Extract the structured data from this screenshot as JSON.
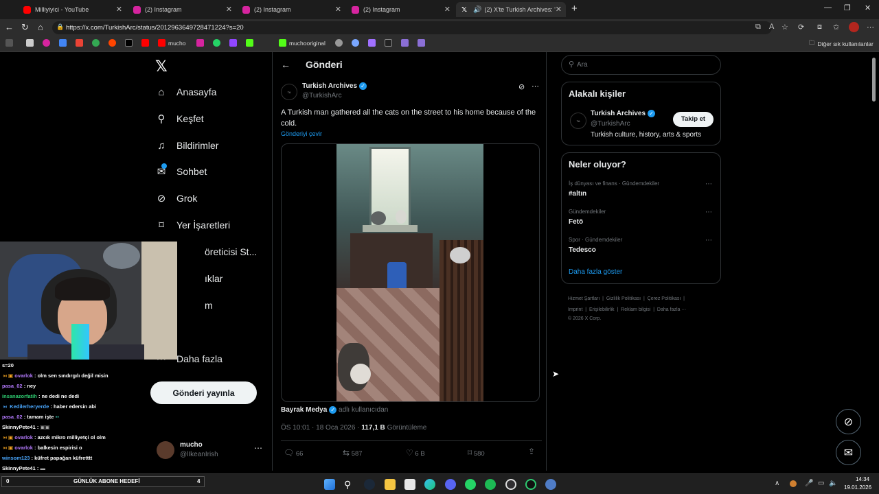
{
  "browser": {
    "tabs": [
      {
        "title": "Milliyiyici - YouTube",
        "color": "#ff0000"
      },
      {
        "title": "(2) Instagram",
        "color": "#d6249f"
      },
      {
        "title": "(2) Instagram",
        "color": "#d6249f"
      },
      {
        "title": "(2) Instagram",
        "color": "#d6249f"
      },
      {
        "title": "(2) X'te Turkish Archives: \"A Tu",
        "color": "#ffffff"
      }
    ],
    "url": "https://x.com/TurkishArc/status/2012963649728471224?s=20",
    "bookmarks": [
      {
        "label": "",
        "color": "#ff0000"
      },
      {
        "label": "mucho",
        "color": "#ff0000"
      },
      {
        "label": "",
        "color": "#d6249f"
      },
      {
        "label": "",
        "color": "#25d366"
      },
      {
        "label": "",
        "color": "#9146ff"
      },
      {
        "label": "muchooriginal",
        "color": "#53fc18"
      },
      {
        "label": "Diğer sık kullanılanlar",
        "color": "#888888"
      }
    ]
  },
  "x": {
    "nav": [
      {
        "label": "Anasayfa",
        "icon": "home-icon",
        "glyph": "⌂"
      },
      {
        "label": "Keşfet",
        "icon": "search-icon",
        "glyph": "⚲"
      },
      {
        "label": "Bildirimler",
        "icon": "bell-icon",
        "glyph": "🔔"
      },
      {
        "label": "Sohbet",
        "icon": "mail-icon",
        "glyph": "✉"
      },
      {
        "label": "Grok",
        "icon": "grok-icon",
        "glyph": "⊘"
      },
      {
        "label": "Yer İşaretleri",
        "icon": "bookmark-icon",
        "glyph": "⌑"
      },
      {
        "label": "öreticisi St...",
        "icon": "",
        "glyph": ""
      },
      {
        "label": "ıklar",
        "icon": "",
        "glyph": ""
      },
      {
        "label": "m",
        "icon": "",
        "glyph": ""
      },
      {
        "label": "Daha fazla",
        "icon": "more-icon",
        "glyph": "⋯"
      }
    ],
    "post_button": "Gönderi yayınla",
    "profile": {
      "name": "mucho",
      "handle": "@lIkeanIrish"
    },
    "header_title": "Gönderi",
    "tweet": {
      "author": "Turkish Archives",
      "handle": "@TurkishArc",
      "text": "A Turkish man gathered all the cats on the street to his home because of the cold.",
      "translate": "Gönderiyi çevir",
      "source_name": "Bayrak Medya",
      "source_suffix": "adlı kullanıcıdan",
      "time": "ÖS 10:01 · 18 Oca 2026 ·",
      "views_count": "117,1 B",
      "views_label": "Görüntüleme",
      "stats": {
        "replies": "66",
        "reposts": "587",
        "likes": "6 B",
        "bookmarks": "580"
      }
    },
    "search_placeholder": "Ara",
    "related": {
      "title": "Alakalı kişiler",
      "name": "Turkish Archives",
      "handle": "@TurkishArc",
      "bio": "Turkish culture, history, arts & sports",
      "follow": "Takip et"
    },
    "trends": {
      "title": "Neler oluyor?",
      "items": [
        {
          "context": "İş dünyası ve finans · Gündemdekiler",
          "topic": "#altın"
        },
        {
          "context": "Gündemdekiler",
          "topic": "Fetö"
        },
        {
          "context": "Spor · Gündemdekiler",
          "topic": "Tedesco"
        }
      ],
      "show_more": "Daha fazla göster"
    },
    "footer": {
      "line1": "Hizmet Şartları  |  Gizlilik Politikası  |  Çerez Politikası  |",
      "line2": "Imprint  |  Erişilebilirlik  |  Reklam bilgisi  |  Daha fazla ···",
      "line3": "© 2026 X Corp."
    }
  },
  "chat": {
    "url_fragment": "s=20",
    "lines": [
      {
        "user": "ovarlok",
        "msg": ": olm sen sındırgılı değil misin",
        "color": "#b57bff"
      },
      {
        "user": "pasa_02",
        "msg": ": ney",
        "color": "#b57bff"
      },
      {
        "user": "insanazorfatih",
        "msg": ": ne dedi ne dedi",
        "color": "#2ecc71"
      },
      {
        "user": "Kedilerheryerde",
        "msg": ": haber edersin abi",
        "color": "#4aa8ff"
      },
      {
        "user": "pasa_02",
        "msg": ": tamam işte",
        "color": "#b57bff"
      },
      {
        "user": "SkinnyPete41",
        "msg": ":",
        "color": "#ffffff"
      },
      {
        "user": "ovarlok",
        "msg": ": azcık mikro milliyetçi ol olm",
        "color": "#b57bff"
      },
      {
        "user": "ovarlok",
        "msg": ": balkesin espirisi o",
        "color": "#b57bff"
      },
      {
        "user": "winsom123",
        "msg": ": küfret papağan küfretttt",
        "color": "#4aa8ff"
      },
      {
        "user": "SkinnyPete41",
        "msg": ":",
        "color": "#ffffff"
      }
    ],
    "goal": {
      "left": "0",
      "label": "GÜNLÜK ABONE HEDEFİ",
      "right": "4"
    }
  },
  "taskbar": {
    "time": "14:34",
    "date": "19.01.2026"
  }
}
